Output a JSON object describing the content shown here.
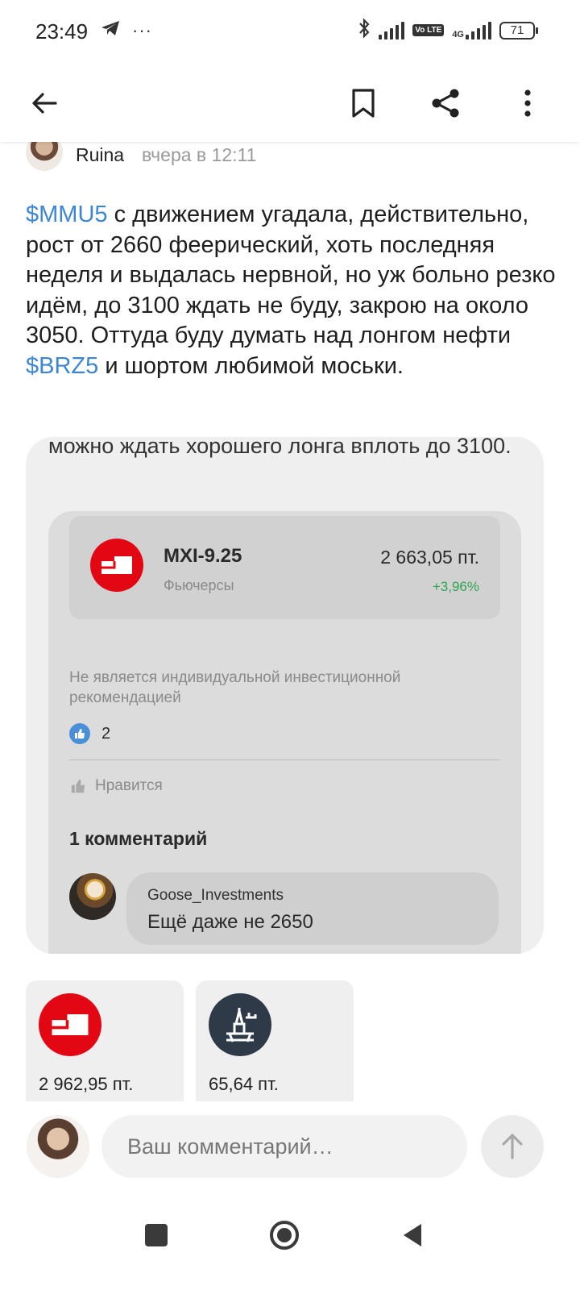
{
  "status_bar": {
    "time": "23:49",
    "battery": "71",
    "network": "4G",
    "volte": "Vo LTE"
  },
  "top_bar": {
    "back_icon": "arrow-left-icon",
    "bookmark_icon": "bookmark-icon",
    "share_icon": "share-icon",
    "more_icon": "more-vertical-icon"
  },
  "post": {
    "author": "Ruina",
    "time": "вчера в 12:11",
    "ticker1": "$MMU5",
    "text_part1": " с движением угадала, действительно, рост от 2660 феерический, хоть последняя неделя и выдалась нервной, но уж больно резко идём, до 3100 ждать не буду, закрою на около 3050. Оттуда буду думать над лонгом нефти ",
    "ticker2": "$BRZ5",
    "text_part2": " и шортом любимой моськи."
  },
  "quote": {
    "text": "можно ждать хорошего лонга вплоть до 3100.",
    "instrument": {
      "name": "MXI-9.25",
      "type": "Фьючерсы",
      "price": "2 663,05  пт.",
      "change": "+3,96%"
    },
    "disclaimer": "Не является индивидуальной инвестиционной рекомендацией",
    "likes_count": "2",
    "like_label": "Нравится",
    "comments_title": "1 комментарий",
    "comment": {
      "author": "Goose_Investments",
      "text": "Ещё даже не 2650"
    }
  },
  "tiles": [
    {
      "price": "2 962,95   пт.",
      "icon": "moex-logo-icon"
    },
    {
      "price": "65,64   пт.",
      "icon": "oil-platform-icon"
    }
  ],
  "comment_input": {
    "placeholder": "Ваш комментарий…"
  },
  "colors": {
    "ticker": "#3d86d4",
    "positive": "#2fa44f",
    "moex_red": "#e30613"
  }
}
